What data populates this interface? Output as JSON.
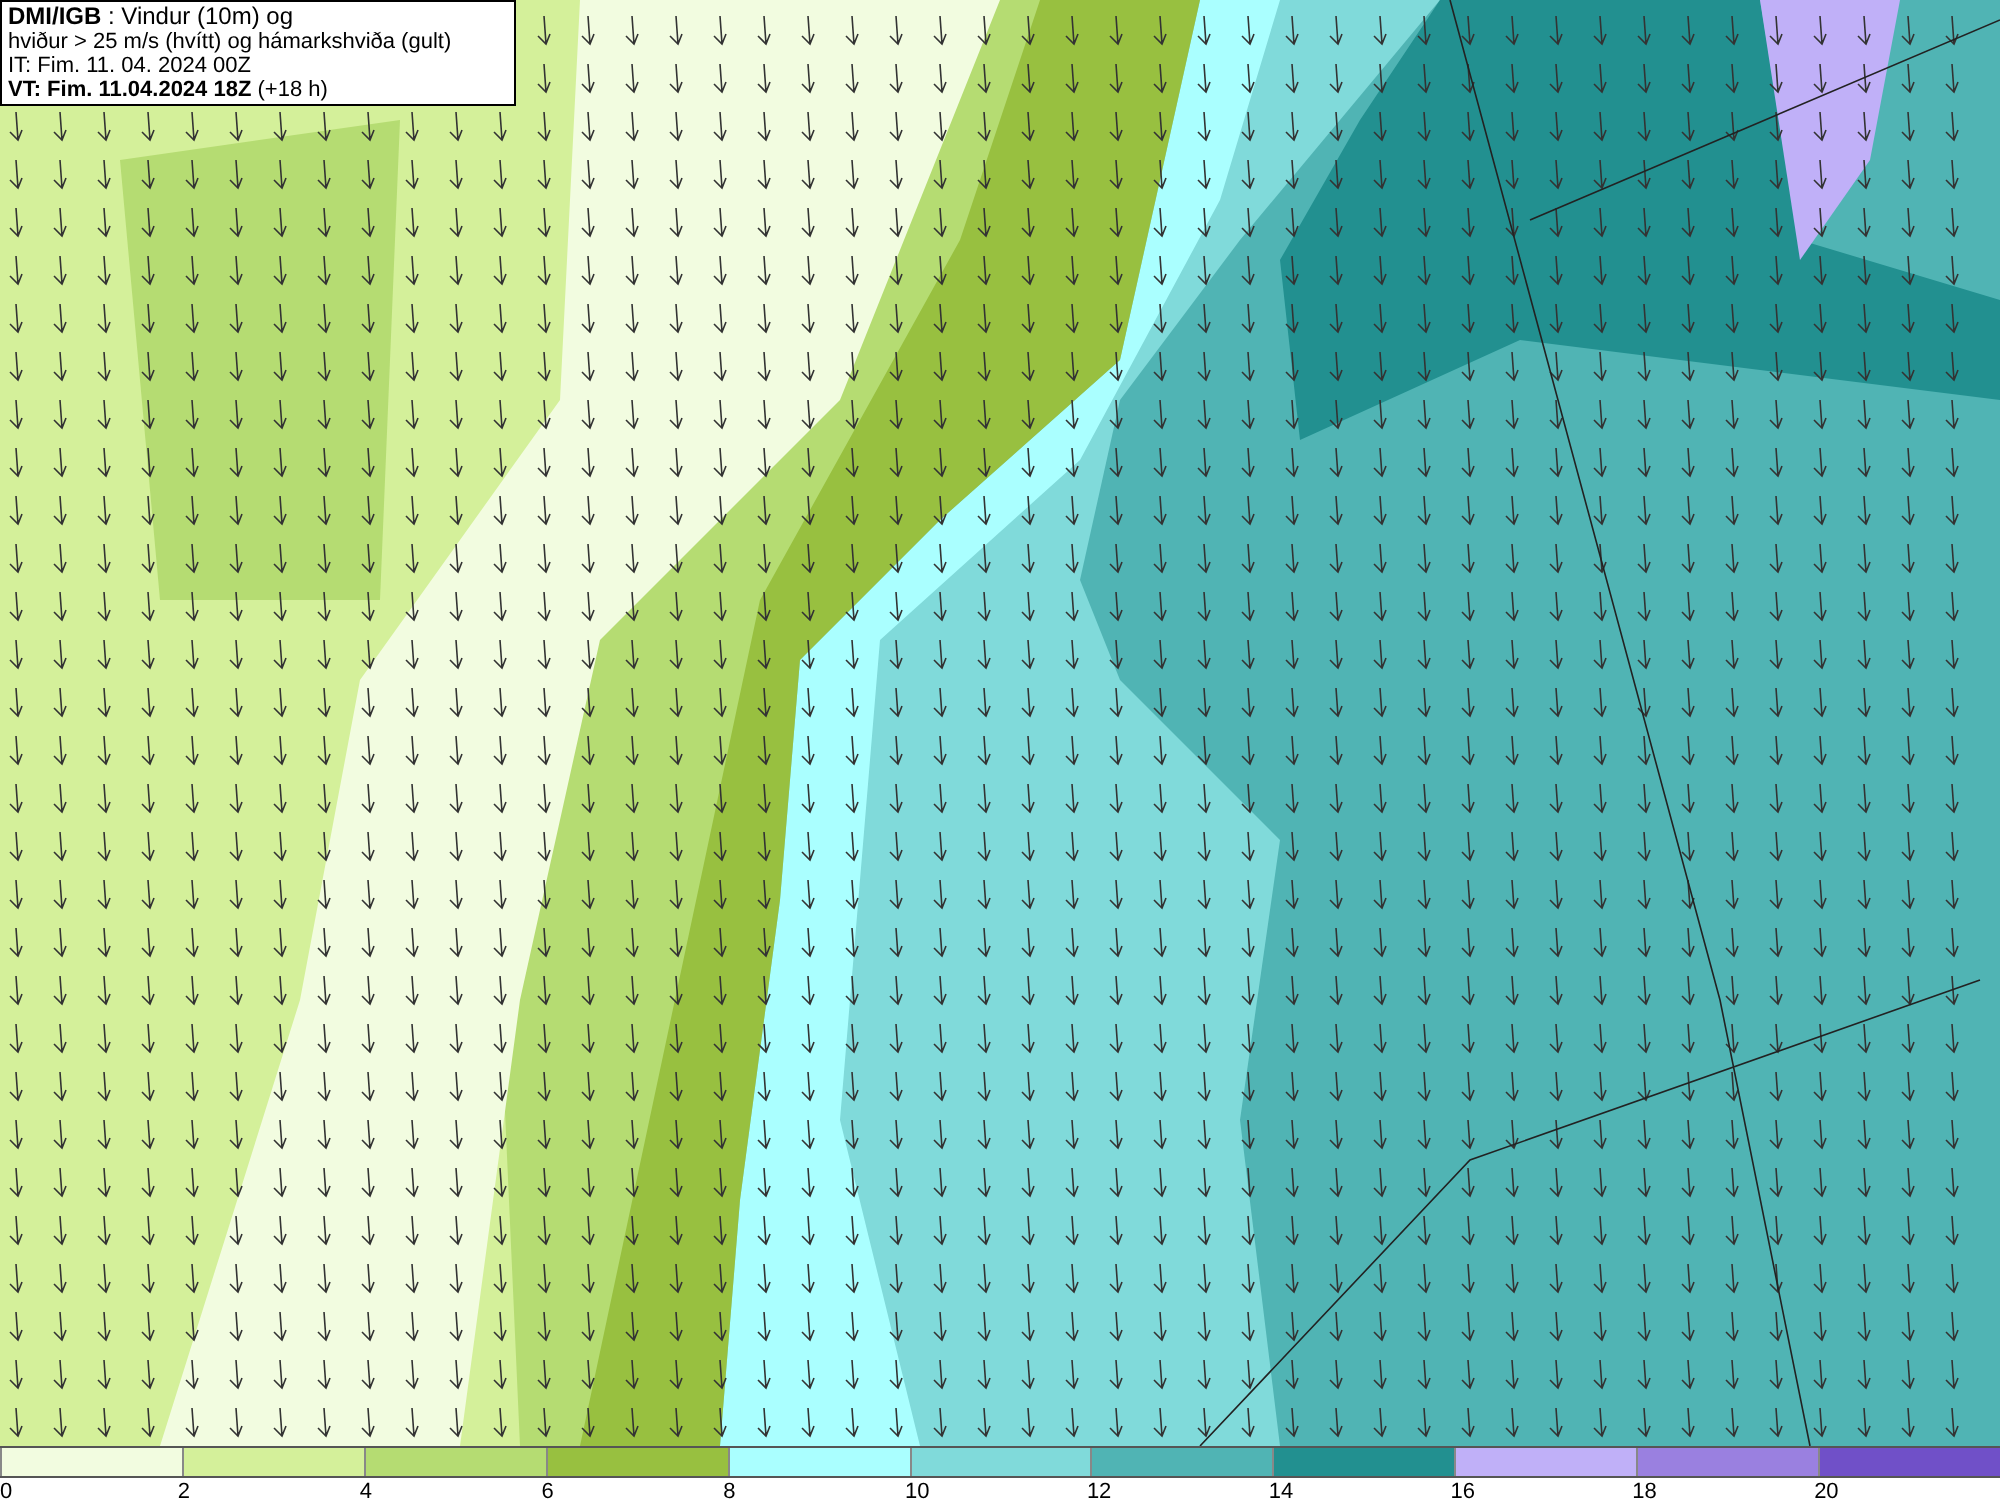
{
  "info_box": {
    "lines": [
      "**DMI/IGB** : Vindur (10m) og",
      "hviður > 25 m/s (hvítt) og hámarkshviða (gult)",
      "IT: Fim. 11. 04. 2024 00Z",
      "**VT: Fim. 11.04.2024 18Z** (+18 h)"
    ]
  },
  "legend": {
    "bins": [
      {
        "color": "#f2fce0"
      },
      {
        "color": "#d4f09a"
      },
      {
        "color": "#b5dc72"
      },
      {
        "color": "#98c040"
      },
      {
        "color": "#aaffff"
      },
      {
        "color": "#80dada"
      },
      {
        "color": "#50b4b4"
      },
      {
        "color": "#229090"
      },
      {
        "color": "#c0b0f8"
      },
      {
        "color": "#9a80e0"
      },
      {
        "color": "#7050c8"
      }
    ],
    "ticks": [
      "0",
      "2",
      "4",
      "6",
      "8",
      "10",
      "12",
      "14",
      "16",
      "18",
      "20"
    ]
  }
}
